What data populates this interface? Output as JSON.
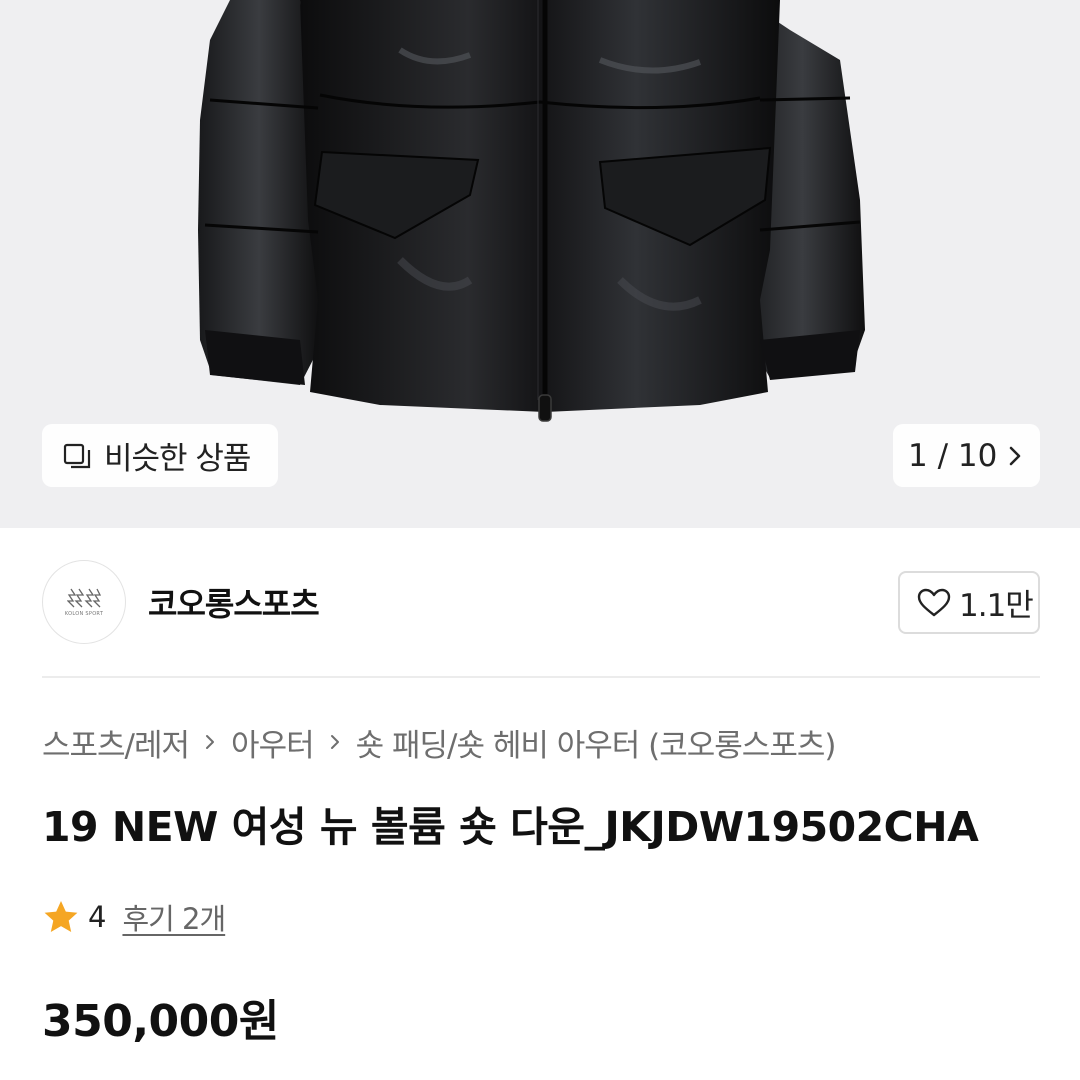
{
  "gallery": {
    "similar_label": "비슷한 상품",
    "counter": "1 / 10"
  },
  "store": {
    "name": "코오롱스포츠",
    "logo_text": "KOLON SPORT",
    "like_count": "1.1만"
  },
  "breadcrumb": {
    "items": [
      "스포츠/레저",
      "아우터",
      "숏 패딩/숏 헤비 아우터 (코오롱스포츠)"
    ]
  },
  "product": {
    "title": "19 NEW 여성 뉴 볼륨 숏 다운_JKJDW19502CHA",
    "rating": "4",
    "reviews": "후기 2개",
    "price": "350,000원"
  },
  "colors": {
    "star": "#f5a623",
    "hero_bg": "#efeff1"
  }
}
